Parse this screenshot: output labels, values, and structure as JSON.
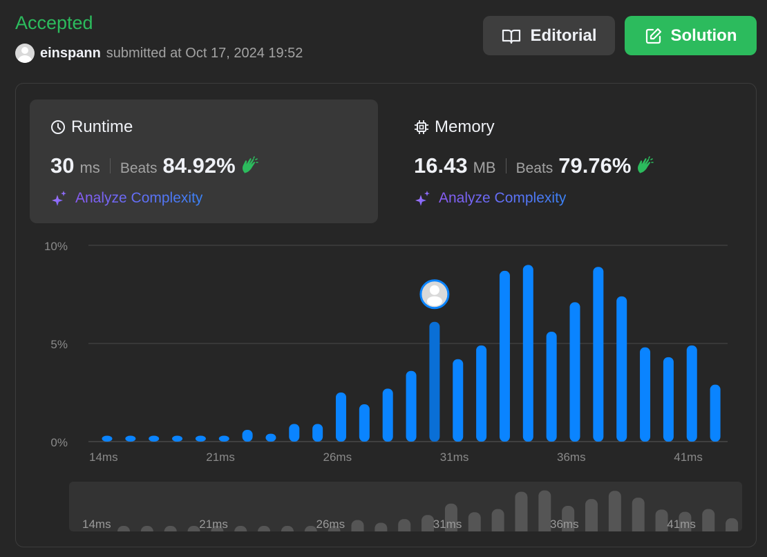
{
  "header": {
    "status": "Accepted",
    "username": "einspann",
    "submitted_text": "submitted at Oct 17, 2024 19:52"
  },
  "buttons": {
    "editorial": "Editorial",
    "solution": "Solution"
  },
  "runtime": {
    "title": "Runtime",
    "value": "30",
    "unit": "ms",
    "beats_label": "Beats",
    "beats_pct": "84.92%",
    "analyze_label": "Analyze Complexity"
  },
  "memory": {
    "title": "Memory",
    "value": "16.43",
    "unit": "MB",
    "beats_label": "Beats",
    "beats_pct": "79.76%",
    "analyze_label": "Analyze Complexity"
  },
  "colors": {
    "accepted": "#2cbb5d",
    "bar": "#0a84ff",
    "bar_highlight": "#0a6fd6",
    "brush_bar": "#555555"
  },
  "chart_data": {
    "type": "bar",
    "x_unit": "ms",
    "x": [
      14,
      15,
      16,
      17,
      18,
      19,
      20,
      21,
      22,
      23,
      24,
      25,
      26,
      27,
      28,
      29,
      30,
      31,
      32,
      33,
      34,
      35,
      36,
      37,
      38,
      39,
      40,
      41,
      42
    ],
    "values": [
      0.3,
      0.3,
      0.3,
      0.3,
      0.3,
      0.3,
      0.6,
      0.4,
      0.9,
      0.9,
      2.5,
      1.9,
      2.7,
      3.6,
      6.1,
      4.2,
      4.9,
      8.7,
      9.0,
      5.6,
      7.1,
      8.9,
      7.4,
      4.8,
      4.3,
      4.9,
      2.9
    ],
    "x_tick_labels": [
      "14ms",
      "21ms",
      "26ms",
      "31ms",
      "36ms",
      "41ms"
    ],
    "y_tick_labels": [
      "10%",
      "5%",
      "0%"
    ],
    "ylim": [
      0,
      10
    ],
    "highlighted_index": 14,
    "grid": true
  }
}
